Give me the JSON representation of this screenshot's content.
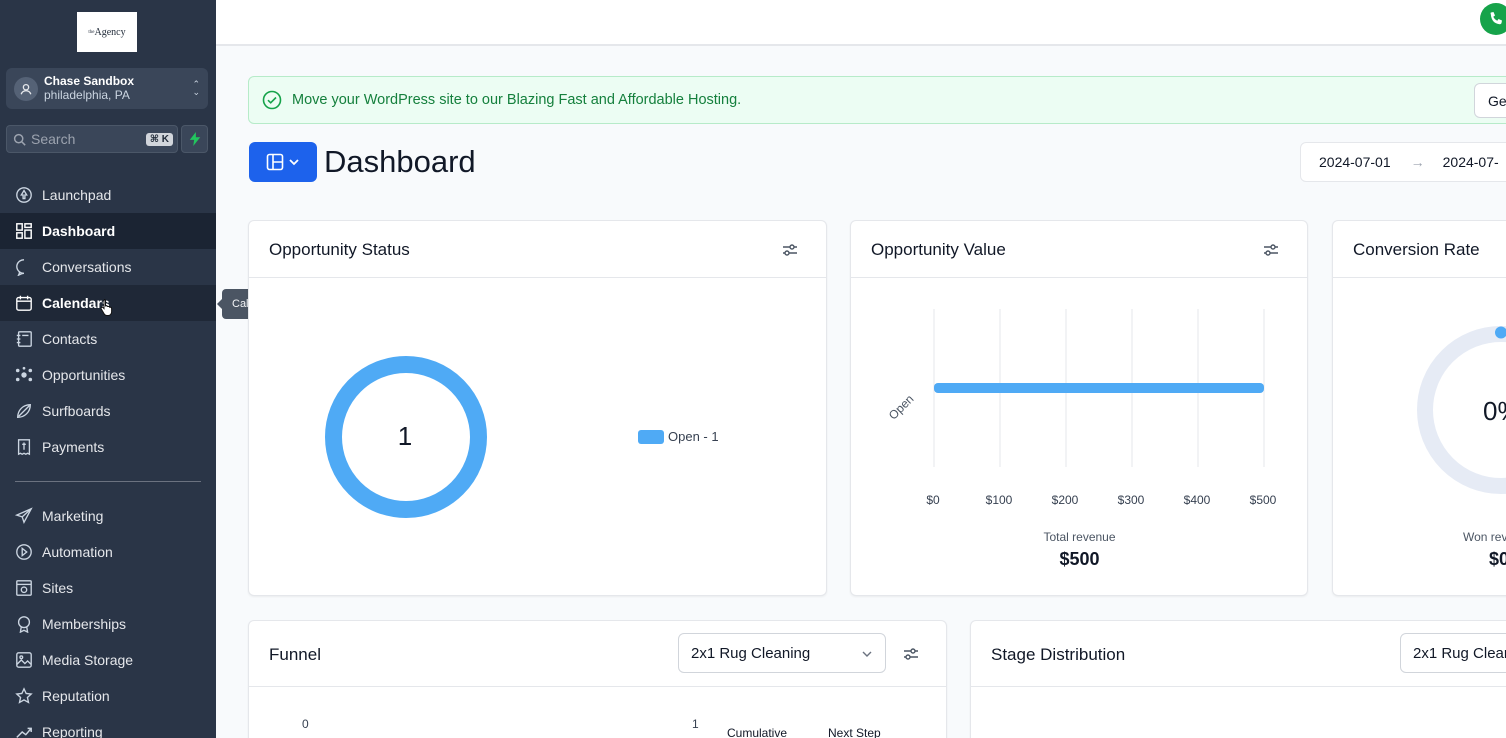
{
  "app": {
    "logo_text": "Agency",
    "logo_sup": "the"
  },
  "account": {
    "name": "Chase Sandbox",
    "location": "philadelphia, PA"
  },
  "search": {
    "placeholder": "Search",
    "shortcut": "⌘ K"
  },
  "nav": {
    "primary": [
      {
        "label": "Launchpad",
        "icon": "rocket-icon"
      },
      {
        "label": "Dashboard",
        "icon": "grid-icon",
        "active": true
      },
      {
        "label": "Conversations",
        "icon": "chat-icon"
      },
      {
        "label": "Calendars",
        "icon": "calendar-icon",
        "hover": true
      },
      {
        "label": "Contacts",
        "icon": "contacts-icon"
      },
      {
        "label": "Opportunities",
        "icon": "network-icon"
      },
      {
        "label": "Payments",
        "icon": "receipt-icon"
      }
    ],
    "surfboards": {
      "label": "Surfboards",
      "icon": "surfboard-icon"
    },
    "secondary": [
      {
        "label": "Marketing",
        "icon": "send-icon"
      },
      {
        "label": "Automation",
        "icon": "play-circle-icon"
      },
      {
        "label": "Sites",
        "icon": "browser-icon"
      },
      {
        "label": "Memberships",
        "icon": "badge-icon"
      },
      {
        "label": "Media Storage",
        "icon": "image-icon"
      },
      {
        "label": "Reputation",
        "icon": "star-icon"
      },
      {
        "label": "Reporting",
        "icon": "trend-icon"
      }
    ]
  },
  "tooltip": "Calendars",
  "banner": {
    "text": "Move your WordPress site to our Blazing Fast and Affordable Hosting.",
    "button": "Ge"
  },
  "header": {
    "title": "Dashboard",
    "date_start": "2024-07-01",
    "date_end": "2024-07-"
  },
  "cards": {
    "opportunity_status": {
      "title": "Opportunity Status",
      "center_value": "1",
      "legend": "Open - 1"
    },
    "opportunity_value": {
      "title": "Opportunity Value",
      "y_label": "Open",
      "ticks": [
        "$0",
        "$100",
        "$200",
        "$300",
        "$400",
        "$500"
      ],
      "total_label": "Total revenue",
      "total_value": "$500"
    },
    "conversion_rate": {
      "title": "Conversion Rate",
      "center_value": "0%",
      "sub_label": "Won rev",
      "sub_value": "$0"
    },
    "funnel": {
      "title": "Funnel",
      "select_value": "2x1 Rug Cleaning",
      "axis_start": "0",
      "axis_end": "1",
      "col_cumulative": "Cumulative",
      "col_next": "Next Step"
    },
    "stage_distribution": {
      "title": "Stage Distribution",
      "select_value": "2x1 Rug Clean"
    }
  },
  "chart_data": [
    {
      "type": "pie",
      "title": "Opportunity Status",
      "categories": [
        "Open"
      ],
      "values": [
        1
      ]
    },
    {
      "type": "bar",
      "title": "Opportunity Value",
      "orientation": "horizontal",
      "categories": [
        "Open"
      ],
      "values": [
        500
      ],
      "xlim": [
        0,
        500
      ],
      "xticks": [
        "$0",
        "$100",
        "$200",
        "$300",
        "$400",
        "$500"
      ],
      "grid": true
    }
  ],
  "colors": {
    "sidebar_bg": "#2a3547",
    "accent": "#1d62ec",
    "chart_blue": "#4faaf5",
    "success": "#16a34a"
  }
}
